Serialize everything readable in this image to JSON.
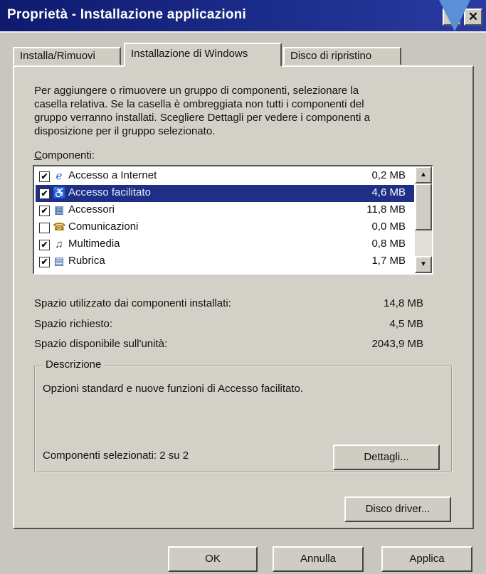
{
  "window": {
    "title": "Proprietà - Installazione applicazioni",
    "help_label": "?",
    "close_label": "✕"
  },
  "tabs": [
    {
      "label": "Installa/Rimuovi"
    },
    {
      "label": "Installazione di Windows"
    },
    {
      "label": "Disco di ripristino"
    }
  ],
  "main": {
    "intro": "Per aggiungere o rimuovere un gruppo di componenti, selezionare la\ncasella relativa. Se la casella è ombreggiata non tutti i componenti del\ngruppo verranno installati. Scegliere Dettagli per vedere i componenti a\ndisposizione per il gruppo selezionato.",
    "components_label_first": "C",
    "components_label_rest": "omponenti:",
    "components": [
      {
        "checked": "✔",
        "icon": "internet-explorer-icon",
        "glyph": "ℯ",
        "label": "Accesso a Internet",
        "size": "0,2 MB"
      },
      {
        "checked": "✔",
        "icon": "accessibility-icon",
        "glyph": "♿",
        "label": "Accesso facilitato",
        "size": "4,6 MB"
      },
      {
        "checked": "✔",
        "icon": "accessories-icon",
        "glyph": "▦",
        "label": "Accessori",
        "size": "11,8 MB"
      },
      {
        "checked": "",
        "icon": "communications-icon",
        "glyph": "☎",
        "label": "Comunicazioni",
        "size": "0,0 MB"
      },
      {
        "checked": "✔",
        "icon": "multimedia-icon",
        "glyph": "♫",
        "label": "Multimedia",
        "size": "0,8 MB"
      },
      {
        "checked": "✔",
        "icon": "address-book-icon",
        "glyph": "▤",
        "label": "Rubrica",
        "size": "1,7 MB"
      }
    ],
    "stats": [
      {
        "label": "Spazio utilizzato dai componenti installati:",
        "value": "14,8 MB"
      },
      {
        "label": "Spazio richiesto:",
        "value": "4,5 MB"
      },
      {
        "label": "Spazio disponibile sull'unità:",
        "value": "2043,9 MB"
      }
    ],
    "description": {
      "title": "Descrizione",
      "text": "Opzioni standard e nuove funzioni di Accesso facilitato.",
      "selected": "Componenti selezionati: 2 su 2"
    },
    "details_button": "Dettagli...",
    "disk_button": "Disco driver..."
  },
  "footer": {
    "ok": "OK",
    "cancel": "Annulla",
    "apply": "Applica"
  },
  "scrollbar": {
    "up": "▲",
    "down": "▼"
  },
  "colors": {
    "titlebar": "#0e1a6e",
    "selection": "#1f2f85",
    "face": "#d3d0c8"
  }
}
